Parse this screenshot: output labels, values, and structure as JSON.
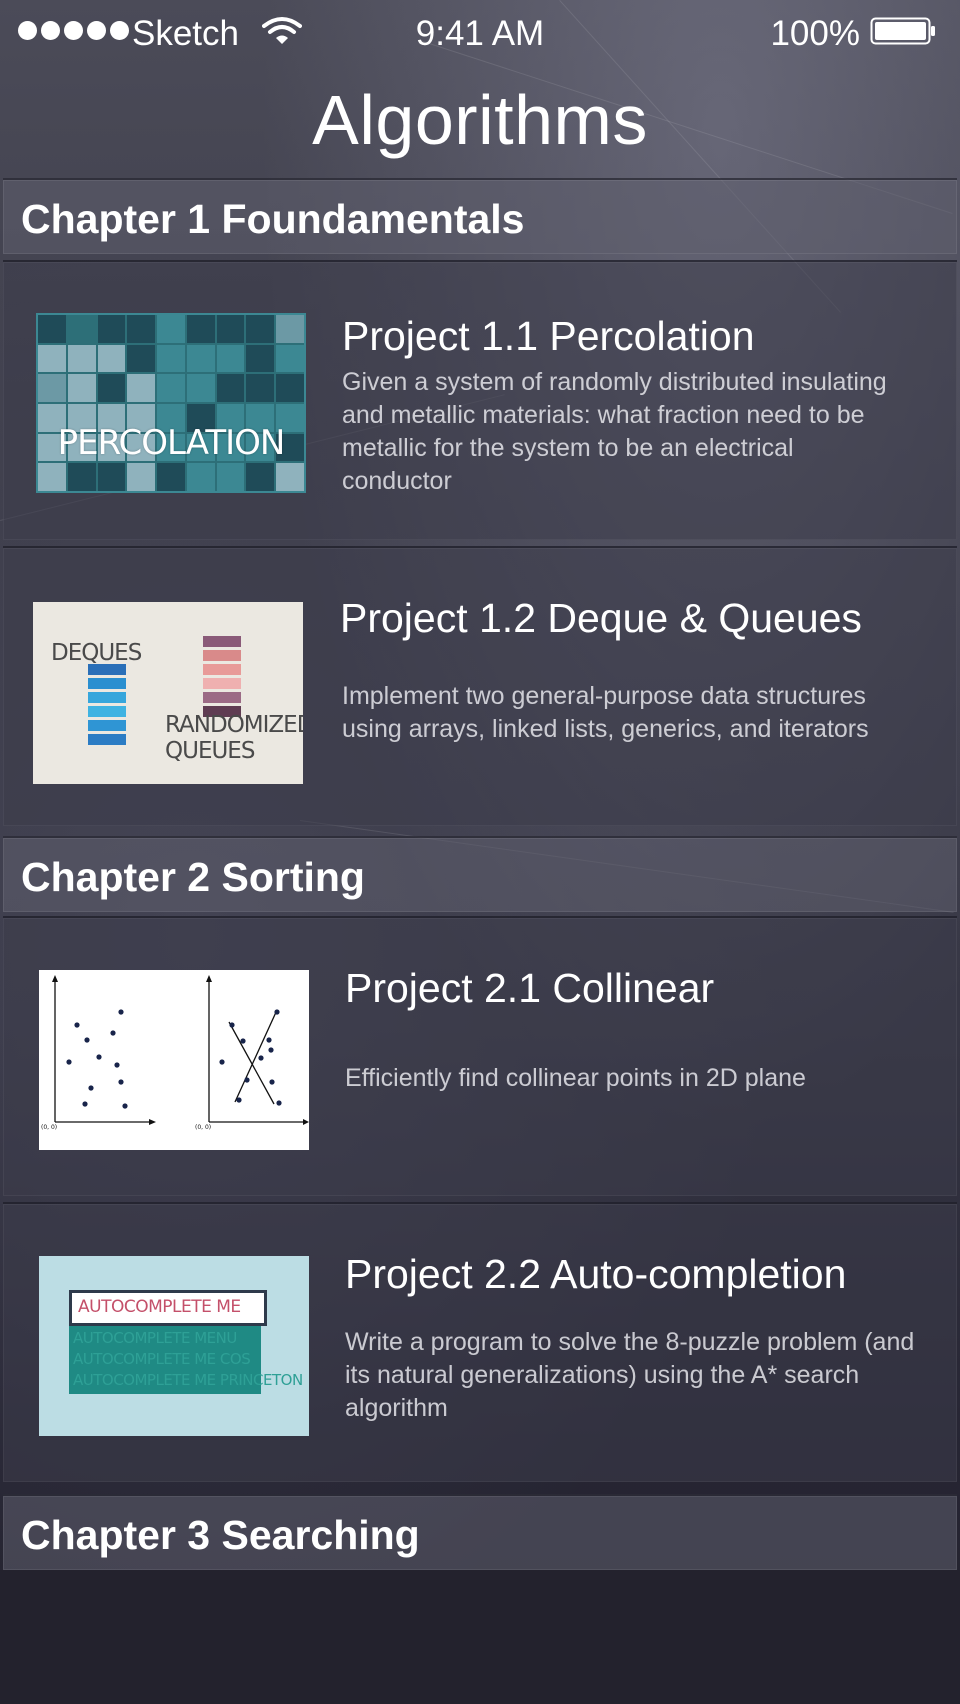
{
  "status_bar": {
    "carrier": "Sketch",
    "time": "9:41 AM",
    "battery": "100%",
    "signal_icon": "signal-dots-icon",
    "wifi_icon": "wifi-icon",
    "battery_icon": "battery-full-icon"
  },
  "nav": {
    "title": "Algorithms"
  },
  "sections": [
    {
      "label": "Chapter 1 Foundamentals",
      "projects": [
        {
          "title": "Project 1.1 Percolation",
          "description": "Given a system of randomly distributed insulating and metallic materials: what fraction need to be metallic for the system to be an electrical conductor",
          "thumb_text": "PERCOLATION"
        },
        {
          "title": "Project 1.2 Deque & Queues",
          "description": "Implement two general-purpose data structures using arrays, linked lists, generics, and iterators",
          "thumb_text_1": "DEQUES",
          "thumb_text_2": "RANDOMIZED",
          "thumb_text_3": "QUEUES"
        }
      ]
    },
    {
      "label": "Chapter 2 Sorting",
      "projects": [
        {
          "title": "Project 2.1 Collinear",
          "description": "Efficiently find collinear points in 2D plane",
          "thumb_origin_label": "(0, 0)"
        },
        {
          "title": "Project 2.2 Auto-completion",
          "description": "Write a program to solve the 8-puzzle problem (and its natural generalizations) using the A* search algorithm",
          "thumb_query": "AUTOCOMPLETE ME",
          "thumb_suggestions": [
            "AUTOCOMPLETE MENU",
            "AUTOCOMPLETE ME COS",
            "AUTOCOMPLETE ME PRINCETON"
          ]
        }
      ]
    },
    {
      "label": "Chapter 3 Searching",
      "projects": []
    }
  ],
  "colors": {
    "background": "#3d3d4a",
    "percolation_teal": "#2d6f78",
    "deque_blue": "#2a8fd0",
    "queue_pink": "#d98a8a",
    "autocomplete_bg": "#bcdde4"
  }
}
